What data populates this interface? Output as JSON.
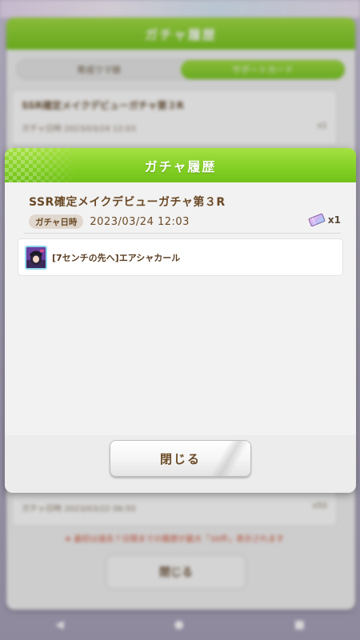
{
  "background": {
    "status_left": "",
    "status_right": "",
    "panel_title": "ガチャ履歴",
    "tabs": [
      {
        "label": "育成ウマ娘",
        "active": false
      },
      {
        "label": "サポートカード",
        "active": true
      }
    ],
    "top_card": {
      "title": "SSR確定メイクデビューガチャ第３R",
      "date_label": "ガチャ日時",
      "date_value": "2023/03/24 12:03",
      "count": "x1"
    },
    "bottom_card": {
      "date_label": "ガチャ日時",
      "date_value": "2023/03/22 06:55",
      "count": "x50"
    },
    "note": "※ 最初は過去７日間までの履歴が最大「30件」表示されます",
    "close_label": "閉じる",
    "nav": [
      "◀",
      "●",
      "■"
    ]
  },
  "dialog": {
    "title": "ガチャ履歴",
    "gacha_name": "SSR確定メイクデビューガチャ第３R",
    "date_label": "ガチャ日時",
    "date_value": "2023/03/24 12:03",
    "ticket_icon": "ticket-icon",
    "ticket_count": "x1",
    "results": [
      {
        "icon": "character-avatar-icon",
        "label": "[7センチの先へ]エアシャカール"
      }
    ],
    "close_label": "閉じる"
  },
  "colors": {
    "header_green": "#83cf24",
    "text_brown": "#6b4a26",
    "badge_bg": "#e0d8cf"
  }
}
